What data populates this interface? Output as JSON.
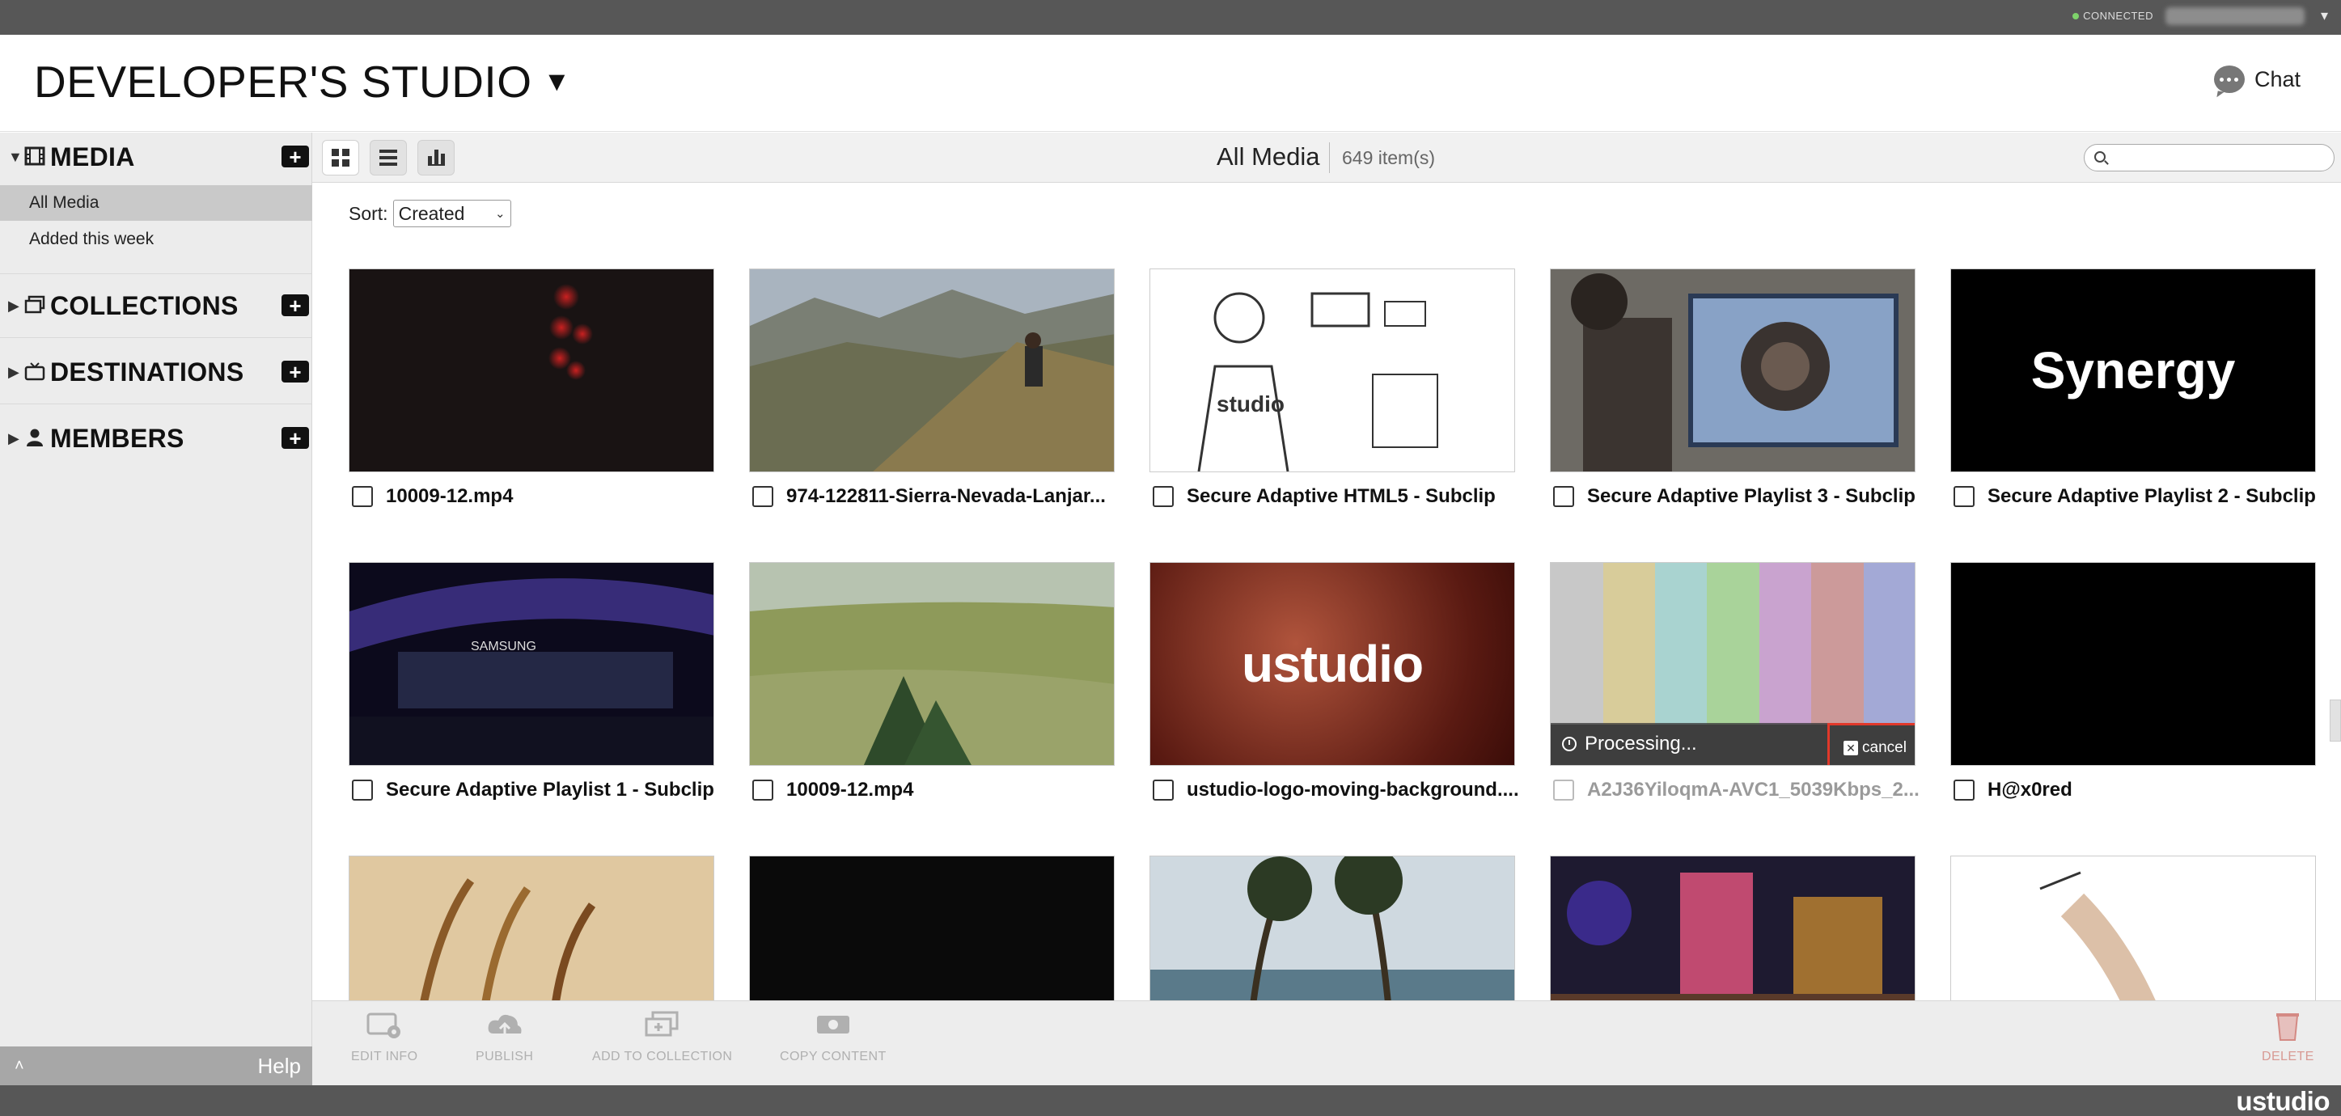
{
  "status": {
    "connected_label": "CONNECTED"
  },
  "header": {
    "studio_title": "DEVELOPER'S STUDIO",
    "caret": "▼",
    "chat_label": "Chat"
  },
  "sidebar": {
    "media": {
      "label": "MEDIA",
      "add": "+",
      "items": [
        {
          "label": "All Media"
        },
        {
          "label": "Added this week"
        }
      ]
    },
    "collections": {
      "label": "COLLECTIONS",
      "add": "+"
    },
    "destinations": {
      "label": "DESTINATIONS",
      "add": "+"
    },
    "members": {
      "label": "MEMBERS",
      "add": "+"
    },
    "bottom": {
      "up": "˄",
      "help": "Help"
    }
  },
  "toolbar": {
    "title": "All Media",
    "count": "649 item(s)",
    "search": {
      "placeholder": ""
    }
  },
  "sort": {
    "label": "Sort:",
    "value": "Created"
  },
  "media": [
    {
      "title": "10009-12.mp4"
    },
    {
      "title": "974-122811-Sierra-Nevada-Lanjar..."
    },
    {
      "title": "Secure Adaptive HTML5 - Subclip"
    },
    {
      "title": "Secure Adaptive Playlist 3 - Subclip"
    },
    {
      "title": "Secure Adaptive Playlist 2 - Subclip",
      "thumb_text": "Synergy"
    },
    {
      "title": "Secure Adaptive Playlist 1 - Subclip"
    },
    {
      "title": "10009-12.mp4"
    },
    {
      "title": "ustudio-logo-moving-background....",
      "thumb_text": "ustudio"
    },
    {
      "title": "A2J36YiloqmA-AVC1_5039Kbps_2...",
      "processing": "Processing...",
      "cancel": "cancel"
    },
    {
      "title": "H@x0red"
    }
  ],
  "actions": {
    "edit_info": "EDIT INFO",
    "publish": "PUBLISH",
    "add_to_collection": "ADD TO COLLECTION",
    "copy_content": "COPY CONTENT",
    "delete": "DELETE"
  },
  "footer": {
    "brand": "ustudio"
  },
  "colors": {
    "chrome": "#575757",
    "sidebar": "#ececec",
    "accent_red": "#e1382a",
    "connected_green": "#7ed36b"
  }
}
